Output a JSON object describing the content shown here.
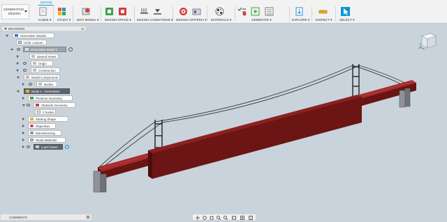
{
  "workspace": {
    "line1": "GENERATIVE",
    "line2": "DESIGN",
    "tab": "DEFINE"
  },
  "toolbar": {
    "groups": [
      {
        "label": "GUIDE ▾"
      },
      {
        "label": "STUDY ▾"
      },
      {
        "label": "EDIT MODEL ▾"
      },
      {
        "label": "DESIGN SPACE ▾"
      },
      {
        "label": "DESIGN CONDITIONS ▾"
      },
      {
        "label": "DESIGN CRITERIA ▾"
      },
      {
        "label": "MATERIALS ▾"
      },
      {
        "label": "GENERATE ▾"
      },
      {
        "label": "EXPLORE ▾"
      },
      {
        "label": "INSPECT ▾"
      },
      {
        "label": "SELECT ▾"
      }
    ]
  },
  "browser": {
    "title": "BROWSER",
    "items": [
      {
        "label": "Generative Studies"
      },
      {
        "label": "Units: Custom"
      },
      {
        "label": "Generative Model 1"
      },
      {
        "label": "Named Views"
      },
      {
        "label": "Origin"
      },
      {
        "label": "Construction"
      },
      {
        "label": "Model Components"
      },
      {
        "label": "Bodies"
      },
      {
        "label": "Study 1 - Generative"
      },
      {
        "label": "Preserve Geometry"
      },
      {
        "label": "Obstacle Geometry"
      },
      {
        "label": "2 bodies"
      },
      {
        "label": "Starting Shape"
      },
      {
        "label": "Objectives"
      },
      {
        "label": "Manufacturing"
      },
      {
        "label": "Study Materials"
      },
      {
        "label": "Load Case1"
      }
    ]
  },
  "comments": {
    "title": "COMMENTS"
  },
  "colors": {
    "accent": "#0696d7",
    "obstacle": "#7a1a1a",
    "tower": "#2b2b2b",
    "viewport": "#c9d3dc"
  }
}
